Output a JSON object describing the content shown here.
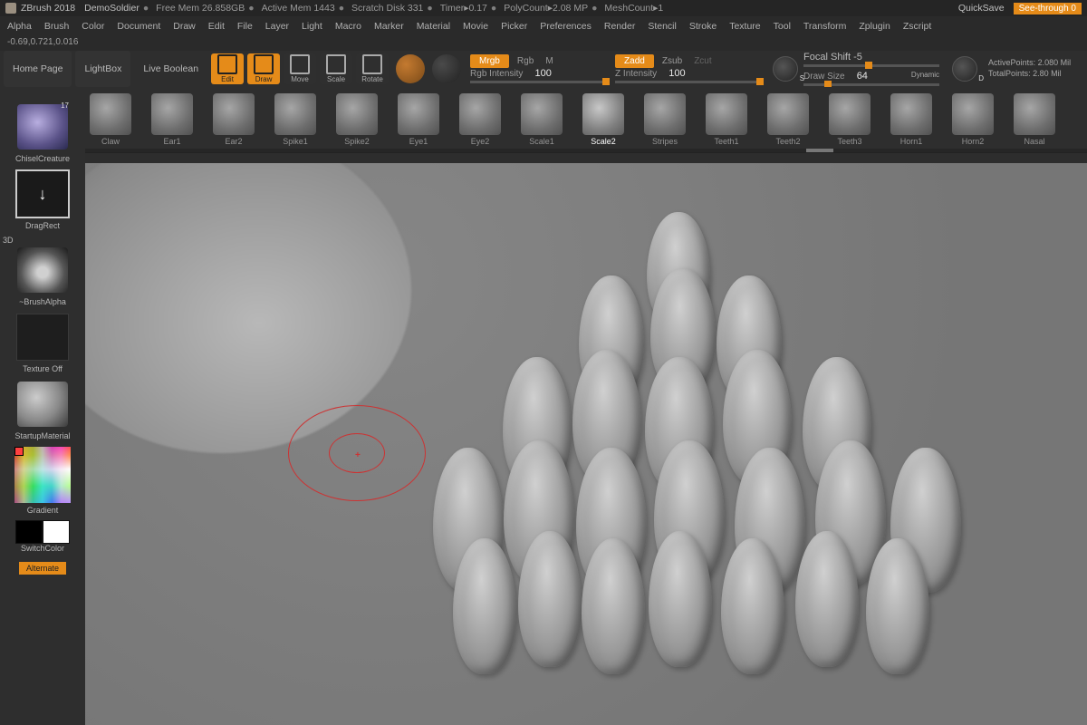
{
  "title_bar": {
    "app": "ZBrush 2018",
    "project": "DemoSoldier",
    "free_mem": "Free Mem 26.858GB",
    "active_mem": "Active Mem 1443",
    "scratch": "Scratch Disk 331",
    "timer": "Timer▸0.17",
    "polycount": "PolyCount▸2.08 MP",
    "meshcount": "MeshCount▸1",
    "quick_save": "QuickSave",
    "see_through": "See-through  0"
  },
  "menu": [
    "Alpha",
    "Brush",
    "Color",
    "Document",
    "Draw",
    "Edit",
    "File",
    "Layer",
    "Light",
    "Macro",
    "Marker",
    "Material",
    "Movie",
    "Picker",
    "Preferences",
    "Render",
    "Stencil",
    "Stroke",
    "Texture",
    "Tool",
    "Transform",
    "Zplugin",
    "Zscript"
  ],
  "coords": "-0.69,0.721,0.016",
  "toolbar": {
    "home": "Home Page",
    "lightbox": "LightBox",
    "live_boolean": "Live Boolean",
    "edit": "Edit",
    "draw": "Draw",
    "move": "Move",
    "scale": "Scale",
    "rotate": "Rotate",
    "mrgb": "Mrgb",
    "rgb": "Rgb",
    "m": "M",
    "rgb_intensity_label": "Rgb Intensity",
    "rgb_intensity_val": "100",
    "zadd": "Zadd",
    "zsub": "Zsub",
    "zcut": "Zcut",
    "z_intensity_label": "Z Intensity",
    "z_intensity_val": "100",
    "focal_shift": "Focal Shift -5",
    "draw_size_label": "Draw Size",
    "draw_size_val": "64",
    "dynamic": "Dynamic",
    "dial_s": "S",
    "dial_d": "D",
    "active_points": "ActivePoints: 2.080 Mil",
    "total_points": "TotalPoints: 2.80 Mil"
  },
  "brushes": [
    "Claw",
    "Ear1",
    "Ear2",
    "Spike1",
    "Spike2",
    "Eye1",
    "Eye2",
    "Scale1",
    "Scale2",
    "Stripes",
    "Teeth1",
    "Teeth2",
    "Teeth3",
    "Horn1",
    "Horn2",
    "Nasal"
  ],
  "brush_selected": "Scale2",
  "shelf": {
    "chisel": "ChiselCreature",
    "chisel_badge": "17",
    "drag_rect": "DragRect",
    "td_label": "3D",
    "alpha": "~BrushAlpha",
    "texture": "Texture Off",
    "material": "StartupMaterial",
    "gradient": "Gradient",
    "switch_color": "SwitchColor",
    "alternate": "Alternate"
  },
  "colors": {
    "orange": "#e58b19",
    "swatch_black": "#000000",
    "swatch_white": "#ffffff"
  }
}
